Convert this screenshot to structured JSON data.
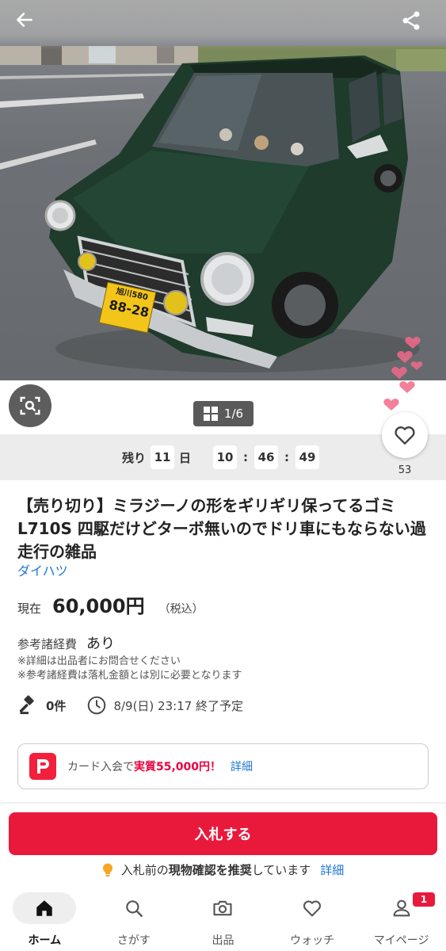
{
  "gallery": {
    "counter": "1/6",
    "plate": {
      "top": "旭川580",
      "bottom": "88-28"
    }
  },
  "countdown": {
    "prefix": "残り",
    "days": "11",
    "days_unit": "日",
    "hours": "10",
    "minutes": "46",
    "seconds": "49",
    "separator": ":"
  },
  "watch": {
    "count": "53"
  },
  "item": {
    "title": "【売り切り】ミラジーノの形をギリギリ保ってるゴミL710S 四駆だけどターボ無いのでドリ車にもならない過走行の雑品",
    "brand": "ダイハツ",
    "price_label": "現在",
    "price": "60,000円",
    "tax": "（税込）",
    "fee_label": "参考諸経費",
    "fee_value": "あり",
    "notes": [
      "※詳細は出品者にお問合せください",
      "※参考諸経費は落札金額とは別に必要となります"
    ],
    "bids": "0件",
    "end_time": "8/9(日) 23:17 終了予定"
  },
  "promo": {
    "prefix": "カード入会で",
    "highlight": "実質55,000円！",
    "link": "詳細"
  },
  "bid_button": "入札する",
  "notice": {
    "pre": "入札前の",
    "bold": "現物確認を推奨",
    "post": "しています",
    "link": "詳細"
  },
  "nav": [
    {
      "label": "ホーム",
      "icon": "home-icon",
      "active": true
    },
    {
      "label": "さがす",
      "icon": "search-icon"
    },
    {
      "label": "出品",
      "icon": "camera-icon"
    },
    {
      "label": "ウォッチ",
      "icon": "heart-icon"
    },
    {
      "label": "マイページ",
      "icon": "person-icon",
      "badge": "1"
    }
  ],
  "colors": {
    "accent": "#e9193c",
    "link": "#1e76d2",
    "car_body": "#1f3b2b"
  }
}
